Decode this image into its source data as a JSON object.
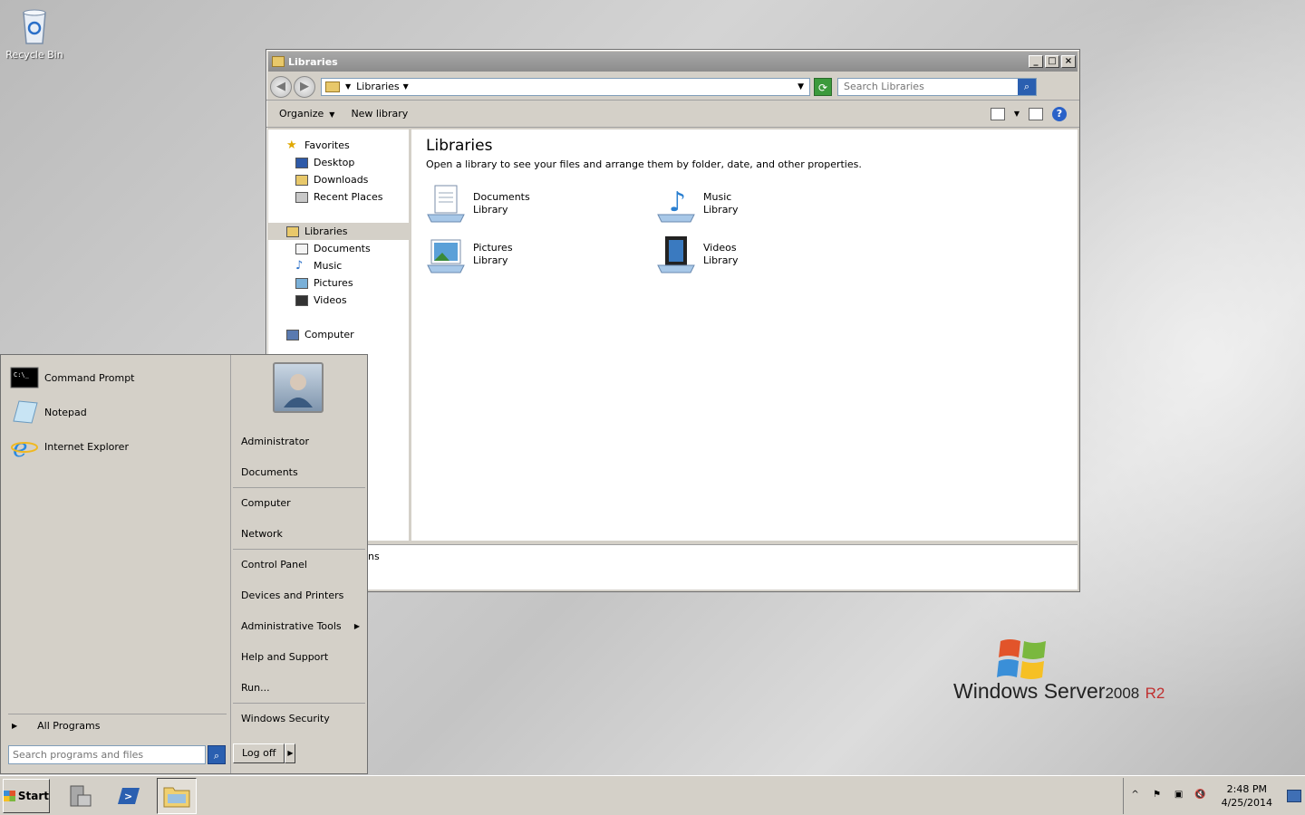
{
  "desktop": {
    "icons": [
      {
        "label": "Recycle Bin",
        "icon": "recycle-bin-icon"
      }
    ]
  },
  "explorer": {
    "title": "Libraries",
    "address": {
      "crumbs": [
        "Libraries"
      ]
    },
    "search_placeholder": "Search Libraries",
    "toolbar": {
      "organize": "Organize",
      "new_library": "New library"
    },
    "nav": {
      "favorites": {
        "label": "Favorites",
        "items": [
          "Desktop",
          "Downloads",
          "Recent Places"
        ]
      },
      "libraries": {
        "label": "Libraries",
        "items": [
          "Documents",
          "Music",
          "Pictures",
          "Videos"
        ]
      },
      "computer": "Computer"
    },
    "content": {
      "heading": "Libraries",
      "description": "Open a library to see your files and arrange them by folder, date, and other properties.",
      "libraries": [
        {
          "name": "Documents",
          "type": "Library",
          "icon": "documents-library-icon"
        },
        {
          "name": "Music",
          "type": "Library",
          "icon": "music-library-icon"
        },
        {
          "name": "Pictures",
          "type": "Library",
          "icon": "pictures-library-icon"
        },
        {
          "name": "Videos",
          "type": "Library",
          "icon": "videos-library-icon"
        }
      ]
    },
    "details_fragment": "ns"
  },
  "start_menu": {
    "programs": [
      "Command Prompt",
      "Notepad",
      "Internet Explorer"
    ],
    "all_programs": "All Programs",
    "search_placeholder": "Search programs and files",
    "right": {
      "user": "Administrator",
      "documents": "Documents",
      "computer": "Computer",
      "network": "Network",
      "control_panel": "Control Panel",
      "devices": "Devices and Printers",
      "admin_tools": "Administrative Tools",
      "help": "Help and Support",
      "run": "Run...",
      "security": "Windows Security"
    },
    "log_off": "Log off"
  },
  "branding": {
    "product": "Windows Server",
    "version": "2008",
    "edition": "R2"
  },
  "taskbar": {
    "start_label": "Start",
    "clock": {
      "time": "2:48 PM",
      "date": "4/25/2014"
    }
  },
  "colors": {
    "accent": "#2a5fb0",
    "window_chrome": "#d4d0c8",
    "title_bar": "#8c8c8c"
  }
}
